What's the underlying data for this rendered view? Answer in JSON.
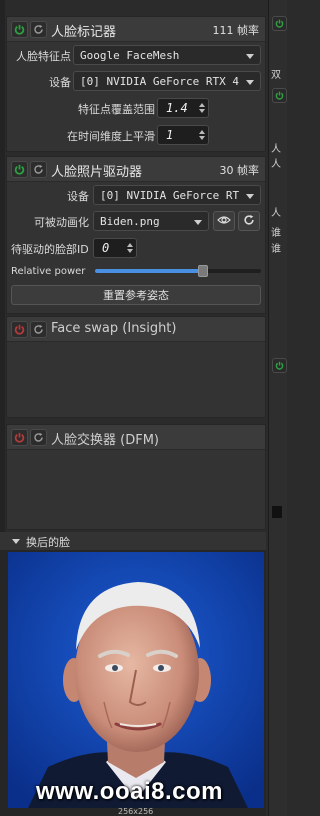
{
  "face_marker": {
    "title": "人脸标记器",
    "fps": "111 帧率",
    "landmarks_label": "人脸特征点",
    "landmarks_value": "Google FaceMesh",
    "device_label": "设备",
    "device_value": "[0] NVIDIA GeForce RTX 4",
    "range_label": "特征点覆盖范围",
    "range_value": "1.4",
    "smooth_label": "在时间维度上平滑",
    "smooth_value": "1"
  },
  "face_animator": {
    "title": "人脸照片驱动器",
    "fps": "30 帧率",
    "device_label": "设备",
    "device_value": "[0] NVIDIA GeForce RT",
    "animatable_label": "可被动画化",
    "animatable_value": "Biden.png",
    "face_id_label": "待驱动的脸部ID",
    "face_id_value": "0",
    "relative_power_label": "Relative power",
    "relative_power_value": 0.65,
    "reset_label": "重置参考姿态"
  },
  "face_swap_insight": {
    "title": "Face swap (Insight)"
  },
  "face_swap_dfm": {
    "title": "人脸交换器 (DFM)"
  },
  "swapped_face": {
    "title": "换后的脸",
    "size_label": "256x256"
  },
  "right_strip": {
    "text_1": "双",
    "text_2": "人",
    "text_3": "人",
    "text_4": "人",
    "text_5": "谁",
    "text_6": "谁"
  },
  "watermark": "www.ooai8.com",
  "colors": {
    "power_on": "#2ea043",
    "power_off": "#b23b3b",
    "slider": "#4a90e2"
  }
}
